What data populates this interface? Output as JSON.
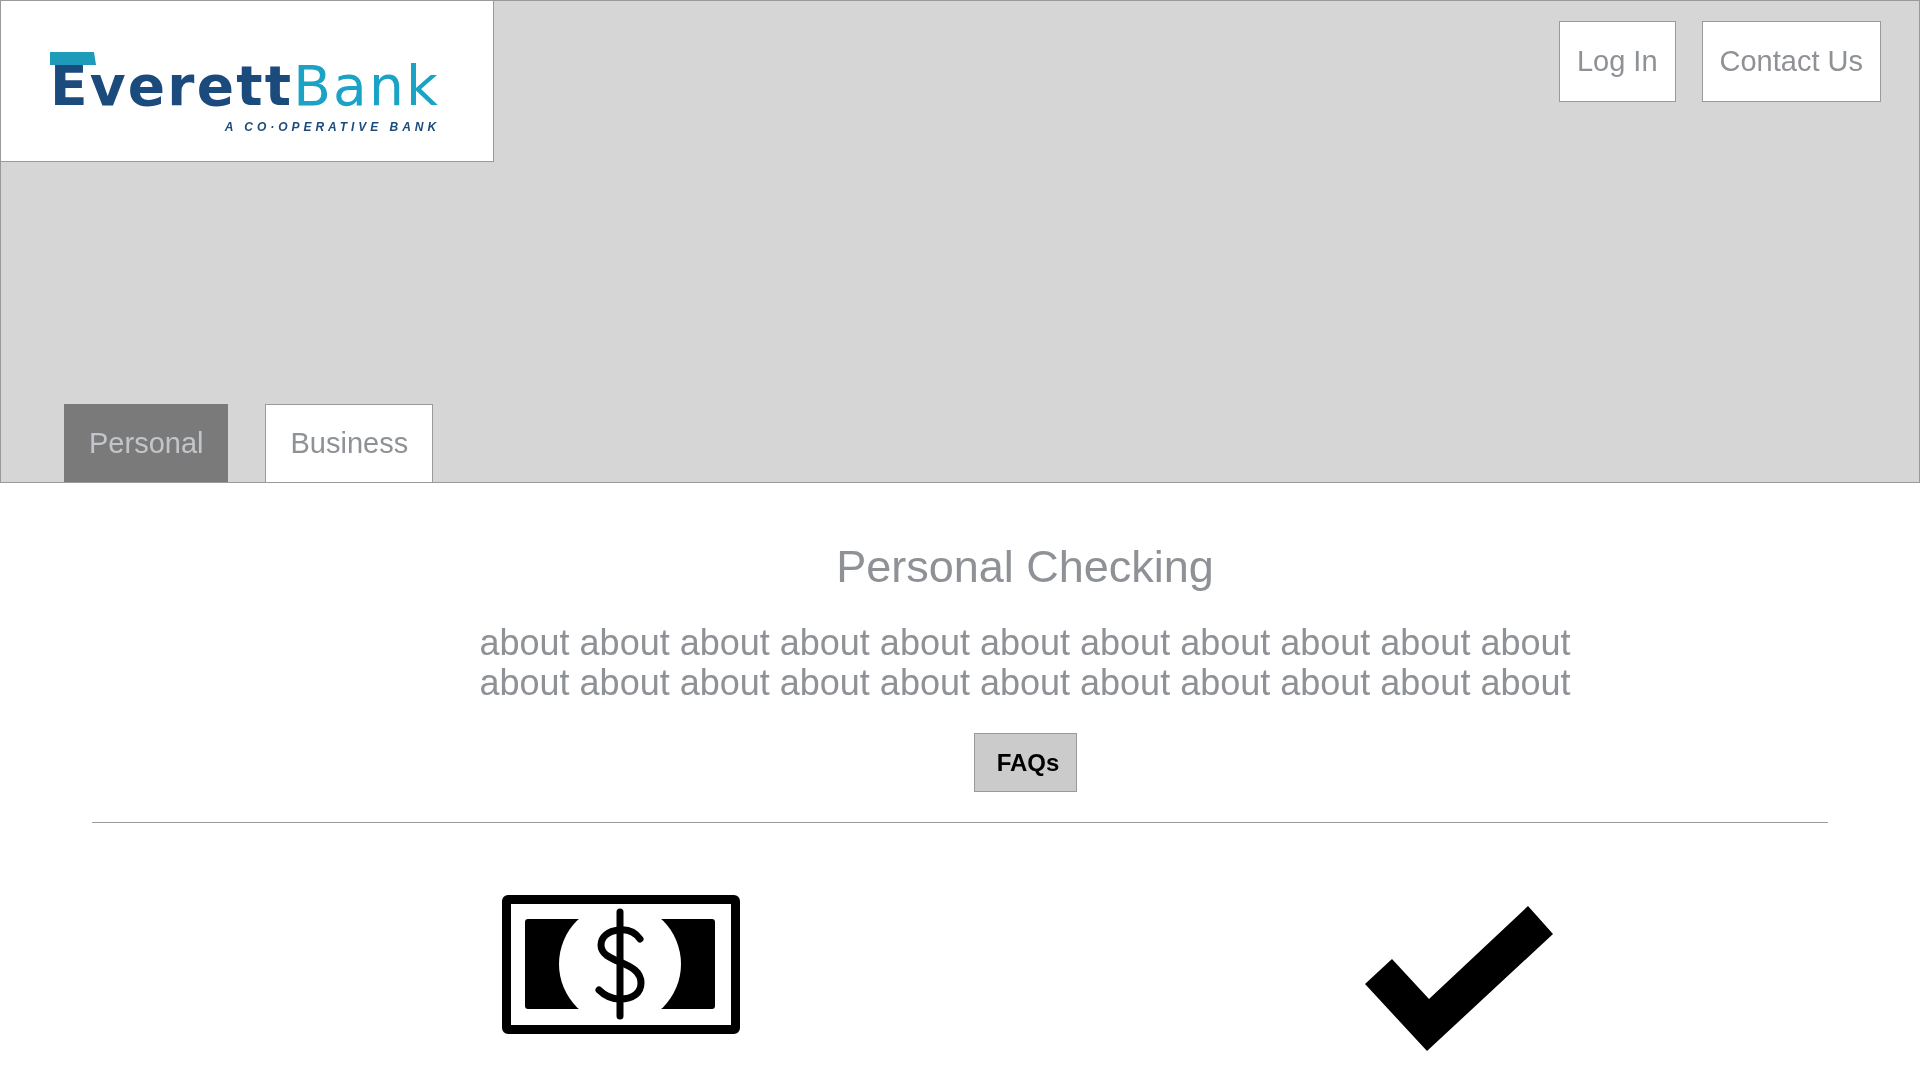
{
  "header": {
    "logo": {
      "wordmark": "**Everett**Bank",
      "tagline": "A CO·OPERATIVE BANK"
    },
    "buttons": [
      "Log In",
      "Contact Us"
    ],
    "tabs": [
      {
        "label": "Personal",
        "selected": true
      },
      {
        "label": "Business",
        "selected": false
      }
    ]
  },
  "section": {
    "title": "Personal Checking",
    "description": "about about about about about about about about about about about about about about about about about about about about about about",
    "button": "FAQs"
  }
}
